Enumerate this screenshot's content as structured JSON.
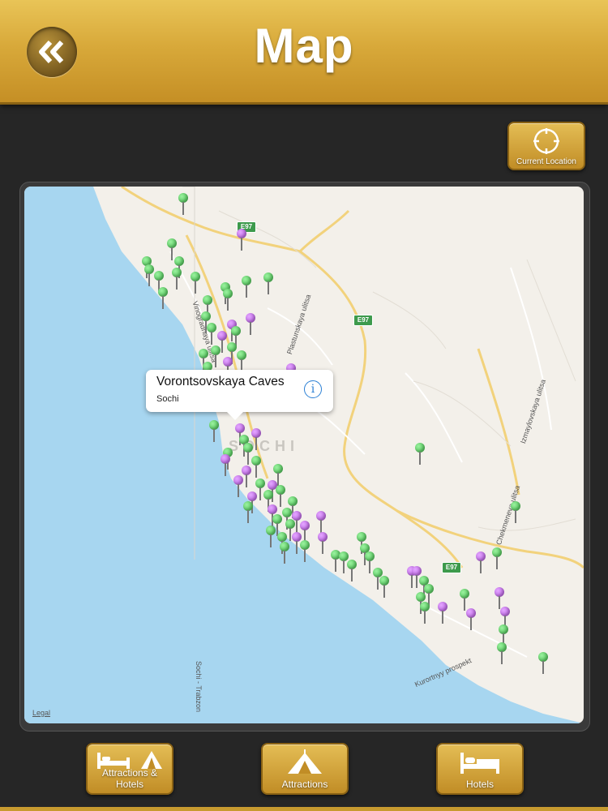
{
  "header": {
    "title": "Map"
  },
  "toolbar": {
    "current_location_label": "Current Location"
  },
  "map": {
    "legal_label": "Legal",
    "city_label": "SOCHI",
    "road_labels": [
      "Vinogradnaya ulitsa",
      "Plastunskaya ulitsa",
      "Izmaylovskaya ulitsa",
      "Chekmeneva ulitsa",
      "Kurortnyy prospekt",
      "Sochi - Trabzon"
    ],
    "route_shields": [
      "E97",
      "E97",
      "E97"
    ],
    "callout": {
      "title": "Vorontsovskaya Caves",
      "subtitle": "Sochi"
    }
  },
  "tabs": [
    {
      "label": "Attractions & Hotels"
    },
    {
      "label": "Attractions"
    },
    {
      "label": "Hotels"
    }
  ],
  "colors": {
    "accent": "#d8a93a",
    "sea": "#a7d6f0",
    "land": "#f3f0ea",
    "pin_attraction": "#3fbf4a",
    "pin_hotel": "#b453df"
  }
}
